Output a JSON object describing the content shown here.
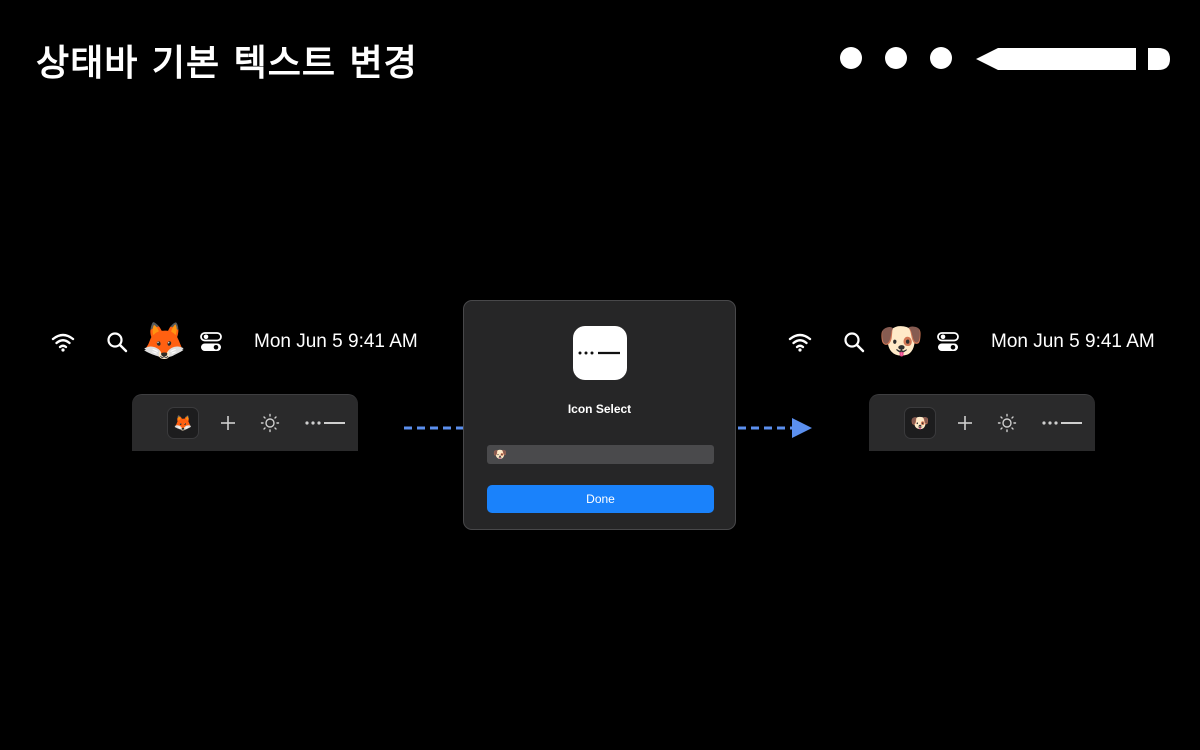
{
  "title": "상태바 기본 텍스트 변경",
  "colors": {
    "background": "#000000",
    "accent": "#1a82fb",
    "arrow": "#5b8fee"
  },
  "before": {
    "menubar": {
      "icons": [
        "wifi-icon",
        "search-icon",
        "fox-emoji",
        "control-center-icon"
      ],
      "emoji": "🦊",
      "clock": "Mon Jun 5  9:41 AM"
    },
    "panel": {
      "icons": [
        "fox-emoji",
        "plus-icon",
        "brightness-icon",
        "dots-line-icon"
      ],
      "emoji": "🦊"
    }
  },
  "dialog": {
    "icon": "dots-line-icon",
    "title": "Icon Select",
    "field_value": "🐶",
    "done_label": "Done"
  },
  "after": {
    "menubar": {
      "icons": [
        "wifi-icon",
        "search-icon",
        "dog-emoji",
        "control-center-icon"
      ],
      "emoji": "🐶",
      "clock": "Mon Jun 5  9:41 AM"
    },
    "panel": {
      "icons": [
        "dog-emoji",
        "plus-icon",
        "brightness-icon",
        "dots-line-icon"
      ],
      "emoji": "🐶"
    }
  }
}
